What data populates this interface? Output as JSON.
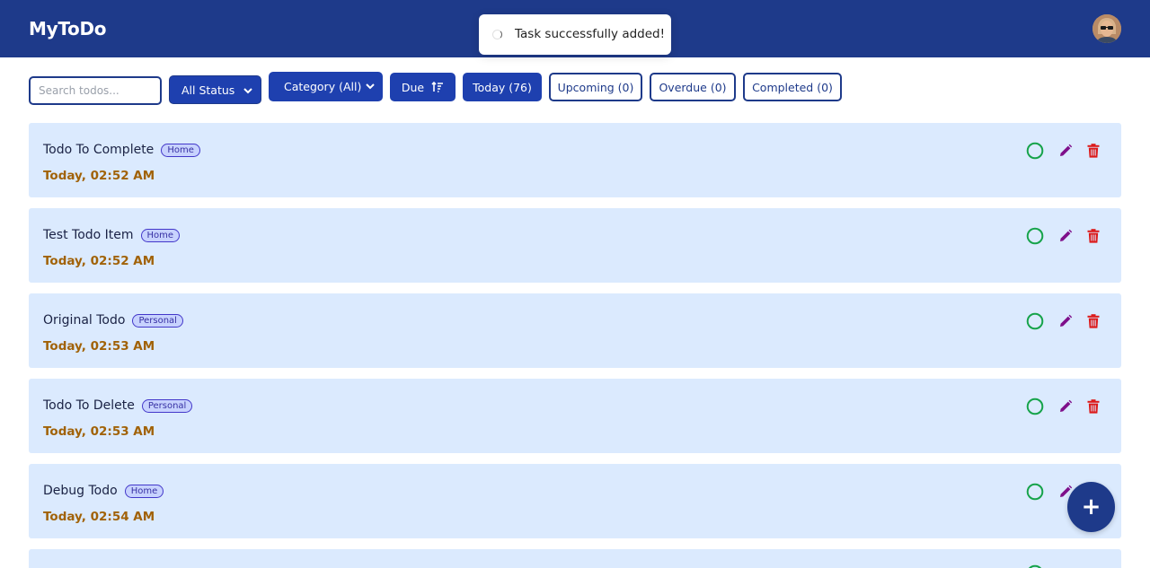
{
  "app": {
    "title": "MyToDo"
  },
  "toast": {
    "message": "Task successfully added!"
  },
  "filters": {
    "search_placeholder": "Search todos...",
    "status_selected": "All Status",
    "category_selected": "Category (All)",
    "due_label": "Due",
    "today_label": "Today (76)",
    "upcoming_label": "Upcoming (0)",
    "overdue_label": "Overdue (0)",
    "completed_label": "Completed (0)"
  },
  "todos": [
    {
      "title": "Todo To Complete",
      "category": "Home",
      "due": "Today, 02:52 AM"
    },
    {
      "title": "Test Todo Item",
      "category": "Home",
      "due": "Today, 02:52 AM"
    },
    {
      "title": "Original Todo",
      "category": "Personal",
      "due": "Today, 02:53 AM"
    },
    {
      "title": "Todo To Delete",
      "category": "Personal",
      "due": "Today, 02:53 AM"
    },
    {
      "title": "Debug Todo",
      "category": "Home",
      "due": "Today, 02:54 AM"
    }
  ],
  "fab": {
    "label": "+"
  },
  "colors": {
    "header": "#1e3a8a",
    "primary_button": "#1e40af",
    "card": "#dbeafe",
    "due_text": "#a16207",
    "complete_icon": "#16a34a",
    "edit_icon": "#7e0f8a",
    "delete_icon": "#dc1a1a"
  },
  "icons": {
    "complete": "circle-outline-icon",
    "edit": "pencil-icon",
    "delete": "trash-icon",
    "sort": "sort-ascending-icon",
    "add": "plus-icon"
  }
}
